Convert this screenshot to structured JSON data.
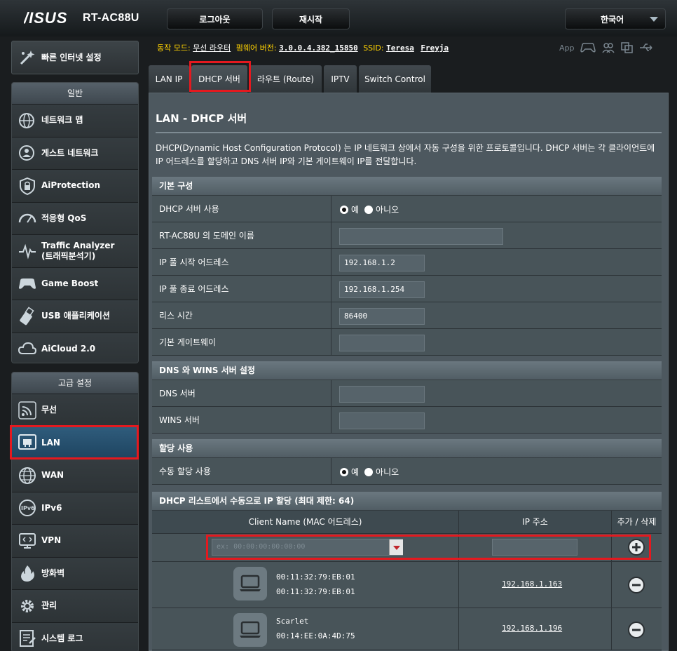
{
  "header": {
    "brand": "/ISUS",
    "model": "RT-AC88U",
    "logout": "로그아웃",
    "restart": "재시작",
    "language": "한국어"
  },
  "status": {
    "mode_label": "동작 모드:",
    "mode_value": "무선 라우터",
    "fw_label": "펌웨어 버전:",
    "fw_value": "3.0.0.4.382_15850",
    "ssid_label": "SSID:",
    "ssid1": "Teresa",
    "ssid2": "Freyja",
    "app": "App"
  },
  "sidebar": {
    "quick": "빠른 인터넷 설정",
    "general_title": "일반",
    "general": [
      "네트워크 맵",
      "게스트 네트워크",
      "AiProtection",
      "적응형 QoS",
      "Traffic Analyzer\n(트래픽분석기)",
      "Game Boost",
      "USB 애플리케이션",
      "AiCloud 2.0"
    ],
    "advanced_title": "고급 설정",
    "advanced": [
      "무선",
      "LAN",
      "WAN",
      "IPv6",
      "VPN",
      "방화벽",
      "관리",
      "시스템 로그"
    ]
  },
  "tabs": [
    "LAN IP",
    "DHCP 서버",
    "라우트 (Route)",
    "IPTV",
    "Switch Control"
  ],
  "page": {
    "title": "LAN - DHCP 서버",
    "description": "DHCP(Dynamic Host Configuration Protocol) 는 IP 네트워크 상에서 자동 구성을 위한 프로토콜입니다. DHCP 서버는 각 클라이언트에 IP 어드레스를 할당하고 DNS 서버 IP와 기본 게이트웨이 IP를 전달합니다."
  },
  "basic": {
    "title": "기본 구성",
    "dhcp_enable_label": "DHCP 서버 사용",
    "yes": "예",
    "no": "아니오",
    "domain_label": "RT-AC88U 의 도메인 이름",
    "domain_value": "",
    "pool_start_label": "IP 풀 시작 어드레스",
    "pool_start_value": "192.168.1.2",
    "pool_end_label": "IP 풀 종료 어드레스",
    "pool_end_value": "192.168.1.254",
    "lease_label": "리스 시간",
    "lease_value": "86400",
    "gateway_label": "기본 게이트웨이",
    "gateway_value": ""
  },
  "dns": {
    "title": "DNS 와 WINS 서버 설정",
    "dns_label": "DNS 서버",
    "wins_label": "WINS 서버"
  },
  "assign": {
    "title": "할당 사용",
    "manual_label": "수동 할당 사용",
    "yes": "예",
    "no": "아니오"
  },
  "list": {
    "title": "DHCP 리스트에서 수동으로 IP 할당 (최대 제한: 64)",
    "col_client": "Client Name (MAC 어드레스)",
    "col_ip": "IP 주소",
    "col_action": "추가 / 삭제",
    "mac_placeholder": "ex: 00:00:00:00:00:00",
    "rows": [
      {
        "name": "00:11:32:79:EB:01",
        "mac": "00:11:32:79:EB:01",
        "ip": "192.168.1.163"
      },
      {
        "name": "Scarlet",
        "mac": "00:14:EE:0A:4D:75",
        "ip": "192.168.1.196"
      }
    ]
  }
}
